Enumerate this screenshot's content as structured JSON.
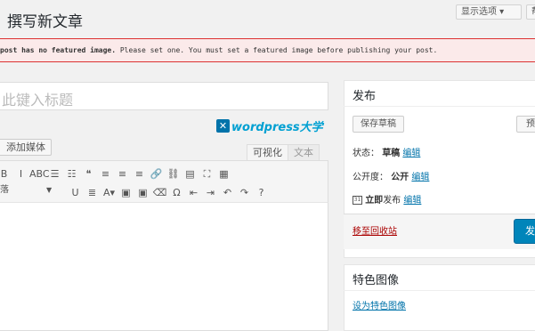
{
  "page": {
    "title": "撰写新文章"
  },
  "top": {
    "screen_options": "显示选项 ▾",
    "help": "帮助"
  },
  "notice": {
    "bold": "post has no featured image.",
    "text": " Please set one. You must set a featured image before publishing your post."
  },
  "editor": {
    "title_placeholder": "此键入标题",
    "add_media": "添加媒体",
    "tab_visual": "可视化",
    "tab_text": "文本",
    "logo_text": "wordpress大学",
    "format_select": "落",
    "toolbar_row1": [
      "B",
      "I",
      "ABC",
      "☰",
      "☷",
      "❝",
      "≡",
      "≡",
      "≡",
      "🔗",
      "⛓",
      "▤",
      "⛶",
      "▦"
    ],
    "toolbar_row2": [
      "U",
      "≣",
      "A▾",
      "▣",
      "▣",
      "⌫",
      "Ω",
      "⇤",
      "⇥",
      "↶",
      "↷",
      "?"
    ]
  },
  "publish": {
    "title": "发布",
    "save_draft": "保存草稿",
    "preview": "预览",
    "status_label": "状态：",
    "status_value": "草稿",
    "edit": "编辑",
    "visibility_label": "公开度：",
    "visibility_value": "公开",
    "calendar_icon_text": "31",
    "publish_when_bold": "立即",
    "publish_when_label": "发布",
    "trash": "移至回收站",
    "publish_button": "发布"
  },
  "featured": {
    "title": "特色图像",
    "set_link": "设为特色图像"
  },
  "colors": {
    "primary": "#0085ba",
    "link": "#0073aa",
    "error": "#dc3232",
    "trash": "#a00"
  }
}
